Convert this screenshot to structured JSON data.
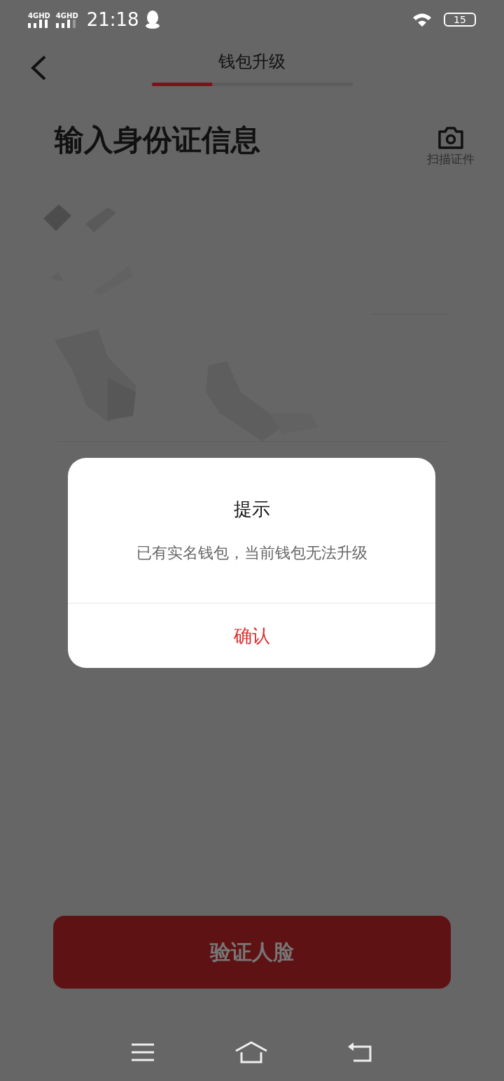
{
  "status_bar": {
    "networks": [
      "4GHD",
      "4GHD"
    ],
    "time": "21:18",
    "battery": "15"
  },
  "header": {
    "title": "钱包升级",
    "progress": {
      "level": 0.3
    }
  },
  "heading": "输入身份证信息",
  "scan": {
    "label": "扫描证件"
  },
  "primary_button": {
    "label": "验证人脸",
    "disabled": true
  },
  "dialog": {
    "title": "提示",
    "message": "已有实名钱包，当前钱包无法升级",
    "confirm": "确认"
  }
}
